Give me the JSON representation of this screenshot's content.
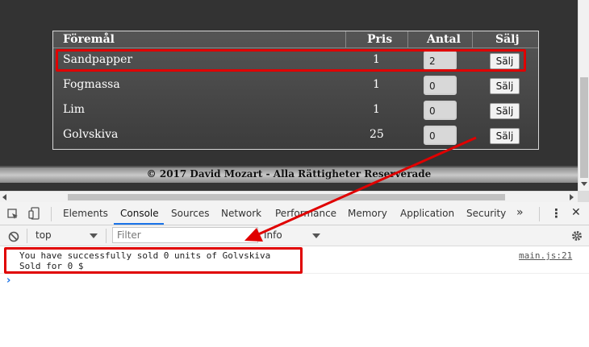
{
  "table": {
    "headers": {
      "item": "Föremål",
      "price": "Pris",
      "qty": "Antal",
      "sell": "Sälj"
    },
    "rows": [
      {
        "name": "Sandpapper",
        "price": "1",
        "qty": "2",
        "sell": "Sälj"
      },
      {
        "name": "Fogmassa",
        "price": "1",
        "qty": "0",
        "sell": "Sälj"
      },
      {
        "name": "Lim",
        "price": "1",
        "qty": "0",
        "sell": "Sälj"
      },
      {
        "name": "Golvskiva",
        "price": "25",
        "qty": "0",
        "sell": "Sälj"
      }
    ]
  },
  "footer": {
    "text": "© 2017 David Mozart - Alla Rättigheter Reserverade"
  },
  "devtools": {
    "tabs": [
      "Elements",
      "Console",
      "Sources",
      "Network",
      "Performance",
      "Memory",
      "Application",
      "Security"
    ],
    "active_tab": "Console",
    "more_tabs": "»",
    "menu_icon": "⋮",
    "close_icon": "✕",
    "context": "top",
    "filter_placeholder": "Filter",
    "level": "Info",
    "messages": [
      {
        "lines": [
          "You have successfully sold 0 units of Golvskiva",
          "Sold for 0 $"
        ],
        "source": "main.js:21"
      }
    ],
    "prompt": "›"
  },
  "colors": {
    "annotation": "#e00000",
    "active_tab_underline": "#1a73e8",
    "page_bg": "#333333"
  }
}
